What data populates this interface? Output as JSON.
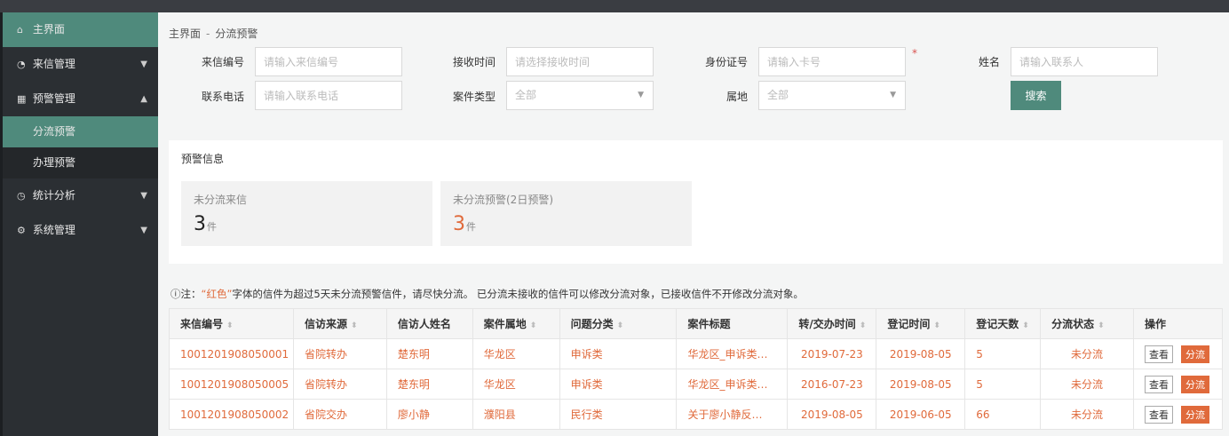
{
  "sidebar": {
    "home": "主界面",
    "menus": [
      {
        "label": "来信管理",
        "icon": "gauge-icon",
        "caret": "▼"
      },
      {
        "label": "预警管理",
        "icon": "grid-icon",
        "caret": "▲"
      },
      {
        "label": "统计分析",
        "icon": "clock-icon",
        "caret": "▼"
      },
      {
        "label": "系统管理",
        "icon": "gear-icon",
        "caret": "▼"
      }
    ],
    "sub": [
      "分流预警",
      "办理预警"
    ]
  },
  "breadcrumb": {
    "root": "主界面",
    "sep": "-",
    "current": "分流预警"
  },
  "form": {
    "letter_no": {
      "label": "来信编号",
      "placeholder": "请输入来信编号"
    },
    "recv_time": {
      "label": "接收时间",
      "placeholder": "请选择接收时间"
    },
    "id_card": {
      "label": "身份证号",
      "placeholder": "请输入卡号",
      "required": "*"
    },
    "name": {
      "label": "姓名",
      "placeholder": "请输入联系人"
    },
    "phone": {
      "label": "联系电话",
      "placeholder": "请输入联系电话"
    },
    "case_type": {
      "label": "案件类型",
      "value": "全部"
    },
    "region": {
      "label": "属地",
      "value": "全部"
    },
    "search": "搜索"
  },
  "alert": {
    "title": "预警信息",
    "cards": [
      {
        "title": "未分流来信",
        "count": "3",
        "unit": "件"
      },
      {
        "title": "未分流预警(2日预警)",
        "count": "3",
        "unit": "件"
      }
    ]
  },
  "note": {
    "prefix": "ⓘ注：",
    "red": "“红色”",
    "text": "字体的信件为超过5天未分流预警信件，请尽快分流。 已分流未接收的信件可以修改分流对象，已接收信件不开修改分流对象。"
  },
  "table": {
    "headers": [
      "来信编号",
      "信访来源",
      "信访人姓名",
      "案件属地",
      "问题分类",
      "案件标题",
      "转/交办时间",
      "登记时间",
      "登记天数",
      "分流状态",
      "操作"
    ],
    "sortable": [
      true,
      true,
      false,
      true,
      true,
      false,
      true,
      true,
      true,
      true,
      false
    ],
    "rows": [
      [
        "1001201908050001",
        "省院转办",
        "楚东明",
        "华龙区",
        "申诉类",
        "华龙区_申诉类…",
        "2019-07-23",
        "2019-08-05",
        "5",
        "未分流"
      ],
      [
        "1001201908050005",
        "省院转办",
        "楚东明",
        "华龙区",
        "申诉类",
        "华龙区_申诉类…",
        "2016-07-23",
        "2019-08-05",
        "5",
        "未分流"
      ],
      [
        "1001201908050002",
        "省院交办",
        "廖小静",
        "濮阳县",
        "民行类",
        "关于廖小静反…",
        "2019-08-05",
        "2019-06-05",
        "66",
        "未分流"
      ]
    ],
    "actions": {
      "view": "查看",
      "split": "分流"
    }
  }
}
